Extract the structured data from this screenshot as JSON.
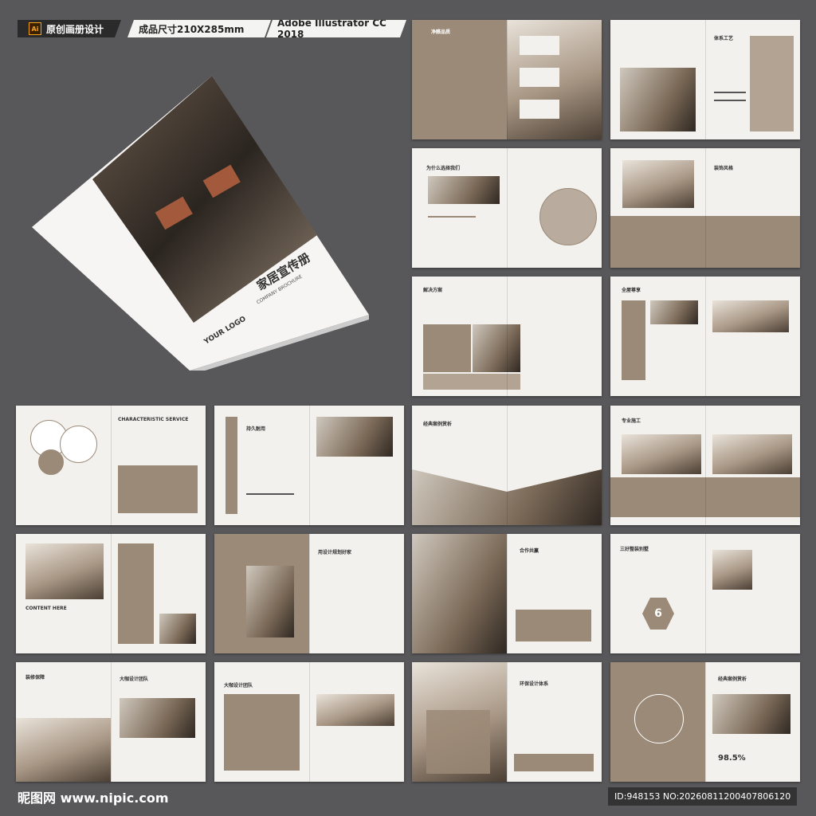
{
  "header": {
    "ai_badge": "Ai",
    "tag1": "原创画册设计",
    "tag2": "成品尺寸210X285mm",
    "tag3": "Adobe Illustrator CC 2018"
  },
  "cover": {
    "title_cn": "家居宣传册",
    "title_en": "COMPANY BROCHURE",
    "logo": "YOUR LOGO"
  },
  "spreads": [
    {
      "title": "净醛品质"
    },
    {
      "title": "体系工艺"
    },
    {
      "title": "为什么选择我们"
    },
    {
      "title": "装饰风格"
    },
    {
      "title": "解决方案"
    },
    {
      "title": "全屋尊享"
    },
    {
      "title": "CHARACTERISTIC SERVICE"
    },
    {
      "title": "持久耐用"
    },
    {
      "title": "经典案例赏析"
    },
    {
      "title": "专业施工"
    },
    {
      "title": "CONTENT HERE"
    },
    {
      "title": "用设计规划好家"
    },
    {
      "title": "合作共赢"
    },
    {
      "title": "三好整装别墅"
    },
    {
      "title": "装修保障"
    },
    {
      "title": "大咖设计团队"
    },
    {
      "title": "环保设计体系"
    },
    {
      "title": "经典案例赏析"
    }
  ],
  "stats": {
    "percent": "98.5%",
    "number": "6"
  },
  "footer": {
    "watermark": "昵图网 www.nipic.com",
    "id": "ID:948153 NO:20260811200407806120"
  }
}
